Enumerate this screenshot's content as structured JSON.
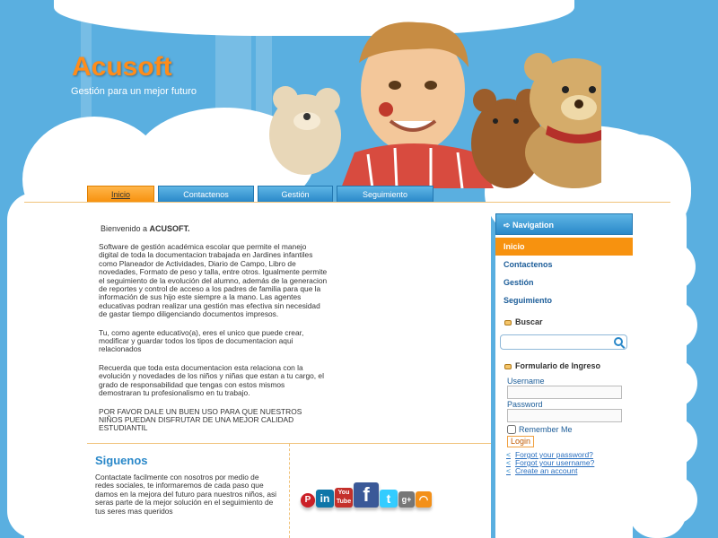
{
  "header": {
    "logo": "Acusoft",
    "slogan": "Gestión para un mejor futuro"
  },
  "nav": {
    "tabs": [
      {
        "label": "Inicio",
        "active": true
      },
      {
        "label": "Contactenos",
        "active": false
      },
      {
        "label": "Gestión",
        "active": false
      },
      {
        "label": "Seguimiento",
        "active": false
      }
    ]
  },
  "content": {
    "welcome_prefix": "Bienvenido a ",
    "welcome_brand": "ACUSOFT.",
    "paragraphs": [
      "Software de gestión académica escolar que permite el manejo digital de toda la documentacion trabajada en Jardines infantiles como Planeador de Actividades, Diario de Campo, Libro de novedades, Formato de peso y talla, entre otros. Igualmente permite el seguimiento de la evolución del alumno, además de la generacion de reportes y control de acceso a los padres de familia para que la información de sus hijo este siempre a la mano. Las agentes educativas podran realizar una gestión mas efectiva sin necesidad de gastar tiempo diligenciando documentos impresos.",
      "Tu, como agente educativo(a), eres el unico que puede crear, modificar y guardar todos los tipos de documentacion aqui relacionados",
      "Recuerda que toda esta documentacion esta relaciona con la evolución y novedades de los niños y niñas que estan a tu cargo, el grado de responsabilidad que tengas con estos mismos demostraran tu profesionalismo en tu trabajo.",
      "POR FAVOR DALE UN BUEN USO PARA QUE NUESTROS NIÑOS PUEDAN DISFRUTAR DE UNA MEJOR CALIDAD ESTUDIANTIL"
    ]
  },
  "siguenos": {
    "title": "Siguenos",
    "text": "Contactate facilmente con nosotros por medio de redes sociales, te informaremos de cada paso que damos en la mejora del futuro para nuestros niños, asi seras parte de la mejor solución en el seguimiento de tus seres mas queridos",
    "icons": [
      {
        "name": "pinterest-icon",
        "glyph": "P",
        "color": "#cb2027"
      },
      {
        "name": "linkedin-icon",
        "glyph": "in",
        "color": "#0e76a8"
      },
      {
        "name": "youtube-icon",
        "glyph": "You Tube",
        "color": "#c4302b"
      },
      {
        "name": "facebook-icon",
        "glyph": "f",
        "color": "#3b5998"
      },
      {
        "name": "twitter-icon",
        "glyph": "t",
        "color": "#33ccff"
      },
      {
        "name": "googleplus-icon",
        "glyph": "g+",
        "color": "#777777"
      },
      {
        "name": "rss-icon",
        "glyph": "◠",
        "color": "#f39019"
      }
    ]
  },
  "sidebar": {
    "heading": "Navigation",
    "items": [
      {
        "label": "Inicio",
        "active": true
      },
      {
        "label": "Contactenos",
        "active": false
      },
      {
        "label": "Gestión",
        "active": false
      },
      {
        "label": "Seguimiento",
        "active": false
      }
    ],
    "search_title": "Buscar",
    "search_value": "",
    "login_title": "Formulario de Ingreso",
    "username_label": "Username",
    "username_value": "",
    "password_label": "Password",
    "password_value": "",
    "remember_label": "Remember Me",
    "login_button": "Login",
    "links": [
      "Forgot your password?",
      "Forgot your username?",
      "Create an account"
    ]
  },
  "colors": {
    "sky": "#5aafe0",
    "accent_orange": "#f7920f",
    "nav_blue": "#2a88c9"
  }
}
